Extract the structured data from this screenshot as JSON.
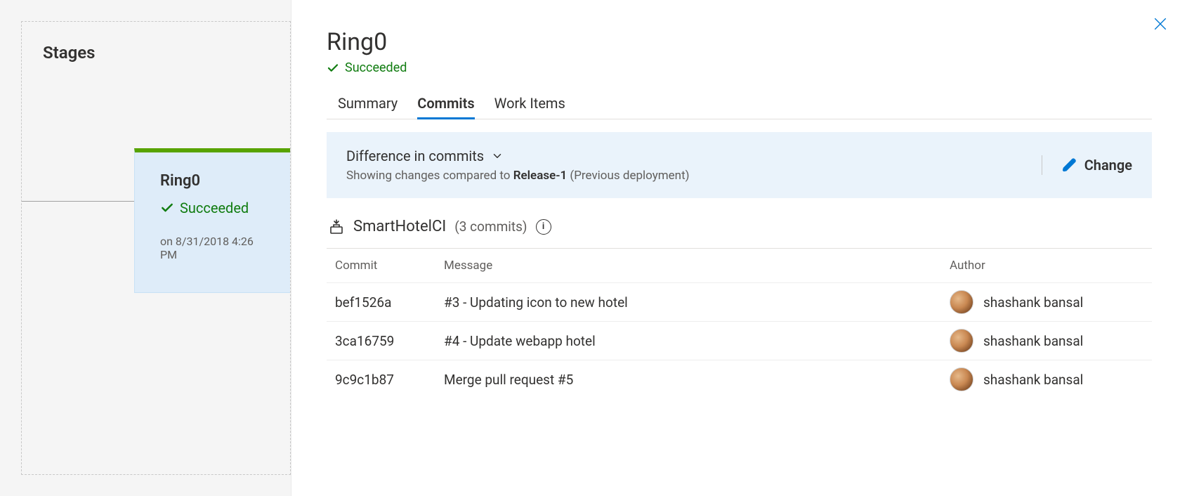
{
  "left": {
    "title": "Stages",
    "card": {
      "name": "Ring0",
      "status": "Succeeded",
      "timestamp": "on 8/31/2018 4:26 PM"
    }
  },
  "panel": {
    "title": "Ring0",
    "status": "Succeeded",
    "tabs": {
      "summary": "Summary",
      "commits": "Commits",
      "workitems": "Work Items"
    },
    "diff": {
      "title": "Difference in commits",
      "sub_prefix": "Showing changes compared to ",
      "sub_strong": "Release-1",
      "sub_suffix": " (Previous deployment)",
      "change_label": "Change"
    },
    "source": {
      "name": "SmartHotelCI",
      "count": "(3 commits)"
    },
    "table": {
      "headers": {
        "commit": "Commit",
        "message": "Message",
        "author": "Author"
      },
      "rows": [
        {
          "commit": "bef1526a",
          "message": "#3 - Updating icon to new hotel",
          "author": "shashank bansal"
        },
        {
          "commit": "3ca16759",
          "message": "#4 - Update webapp hotel",
          "author": "shashank bansal"
        },
        {
          "commit": "9c9c1b87",
          "message": "Merge pull request #5",
          "author": "shashank bansal"
        }
      ]
    }
  }
}
